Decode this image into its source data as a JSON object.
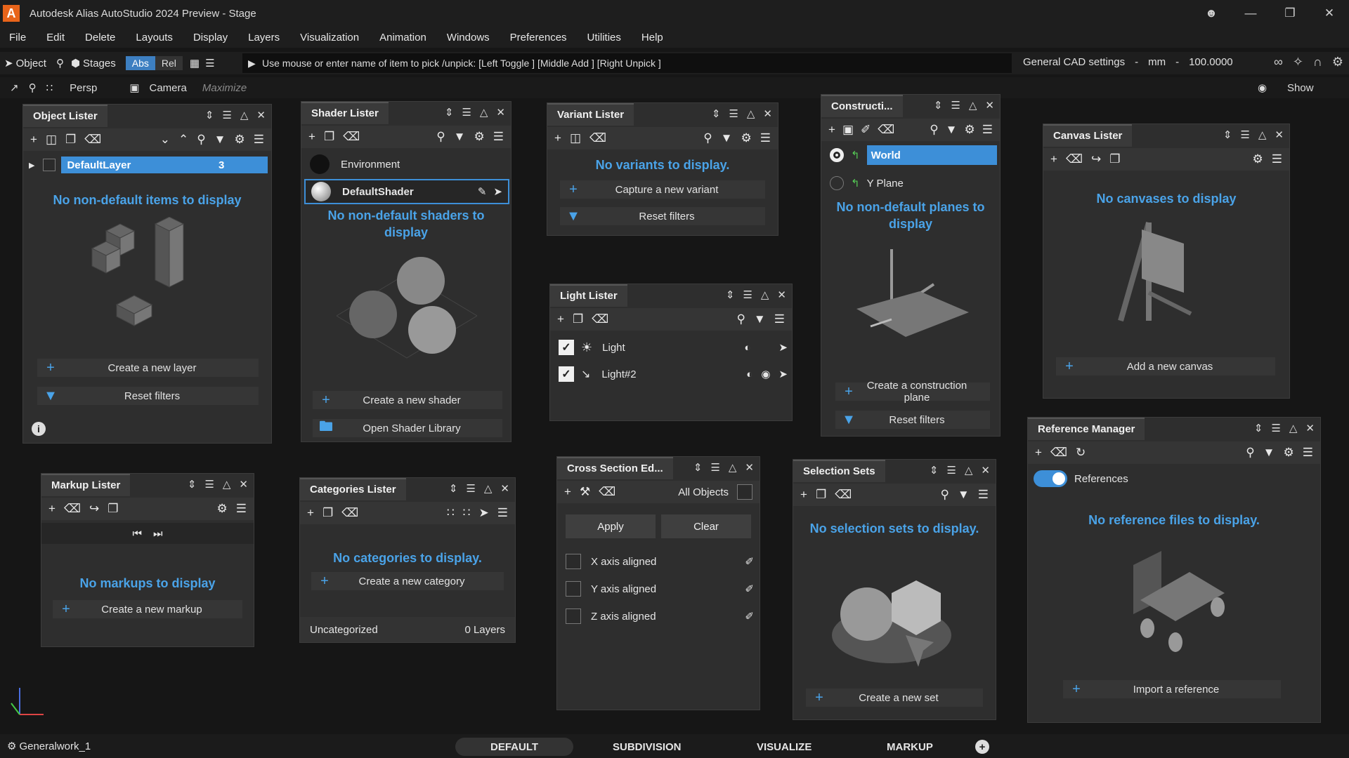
{
  "window": {
    "title": "Autodesk Alias AutoStudio 2024 Preview    - Stage",
    "logo": "A"
  },
  "menu": [
    "File",
    "Edit",
    "Delete",
    "Layouts",
    "Display",
    "Layers",
    "Visualization",
    "Animation",
    "Windows",
    "Preferences",
    "Utilities",
    "Help"
  ],
  "toolbar": {
    "object": "Object",
    "stages": "Stages",
    "abs": "Abs",
    "rel": "Rel",
    "prompt": "Use mouse or enter name of item to pick /unpick: [Left Toggle ] [Middle Add ] [Right Unpick ]",
    "cad_settings": "General CAD settings",
    "dash1": "-",
    "unit": "mm",
    "dash2": "-",
    "scale": "100.0000"
  },
  "viewbar": {
    "persp": "Persp",
    "camera": "Camera",
    "maximize": "Maximize",
    "show": "Show"
  },
  "object_lister": {
    "title": "Object Lister",
    "layer_name": "DefaultLayer",
    "layer_count": "3",
    "empty": "No non-default items to display",
    "create": "Create a new layer",
    "reset": "Reset filters"
  },
  "shader_lister": {
    "title": "Shader Lister",
    "items": [
      "Environment",
      "DefaultShader"
    ],
    "empty": "No non-default shaders to display",
    "create": "Create a new shader",
    "library": "Open Shader Library"
  },
  "variant_lister": {
    "title": "Variant Lister",
    "empty": "No variants to display.",
    "capture": "Capture a new variant",
    "reset": "Reset filters"
  },
  "light_lister": {
    "title": "Light Lister",
    "lights": [
      "Light",
      "Light#2"
    ]
  },
  "construction": {
    "title": "Constructi...",
    "planes": [
      "World",
      "Y Plane"
    ],
    "empty": "No non-default planes to display",
    "create": "Create a construction plane",
    "reset": "Reset filters"
  },
  "canvas_lister": {
    "title": "Canvas Lister",
    "empty": "No canvases to display",
    "add": "Add a new canvas"
  },
  "reference_manager": {
    "title": "Reference Manager",
    "toggle_label": "References",
    "empty": "No reference files to display.",
    "import": "Import a reference"
  },
  "markup_lister": {
    "title": "Markup Lister",
    "empty": "No markups to display",
    "create": "Create a new markup"
  },
  "categories_lister": {
    "title": "Categories Lister",
    "empty": "No categories to display.",
    "create": "Create a new category",
    "footer_left": "Uncategorized",
    "footer_right": "0 Layers"
  },
  "cross_section": {
    "title": "Cross Section Ed...",
    "all_objects": "All Objects",
    "apply": "Apply",
    "clear": "Clear",
    "axes": [
      "X axis aligned",
      "Y axis aligned",
      "Z axis aligned"
    ]
  },
  "selection_sets": {
    "title": "Selection Sets",
    "empty": "No selection sets to display.",
    "create": "Create a new set"
  },
  "status": {
    "workspace": "Generalwork_1",
    "tabs": [
      "DEFAULT",
      "SUBDIVISION",
      "VISUALIZE",
      "MARKUP"
    ]
  },
  "colors": {
    "accent": "#4aa3e8",
    "selected": "#3d8fd8",
    "logo": "#e8641a"
  }
}
